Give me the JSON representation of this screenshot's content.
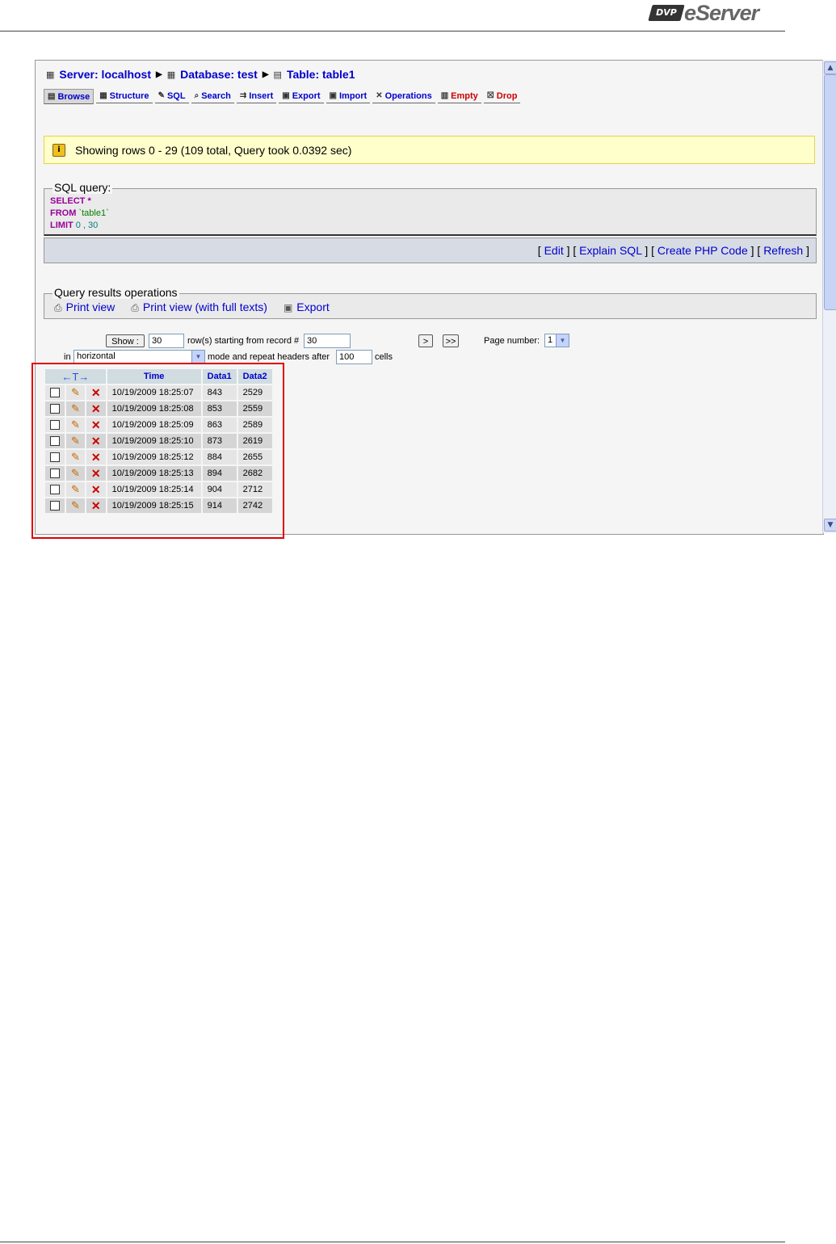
{
  "brand": {
    "badge": "DVP",
    "word": "eServer"
  },
  "breadcrumb": {
    "server": "Server: localhost",
    "database": "Database: test",
    "table": "Table: table1"
  },
  "tabs": [
    {
      "label": "Browse",
      "icon": "browse-icon"
    },
    {
      "label": "Structure",
      "icon": "structure-icon"
    },
    {
      "label": "SQL",
      "icon": "sql-icon"
    },
    {
      "label": "Search",
      "icon": "search-icon"
    },
    {
      "label": "Insert",
      "icon": "insert-icon"
    },
    {
      "label": "Export",
      "icon": "export-icon"
    },
    {
      "label": "Import",
      "icon": "import-icon"
    },
    {
      "label": "Operations",
      "icon": "operations-icon"
    },
    {
      "label": "Empty",
      "icon": "empty-icon"
    },
    {
      "label": "Drop",
      "icon": "drop-icon"
    }
  ],
  "notice": {
    "text": "Showing rows 0 - 29 (109 total, Query took 0.0392 sec)"
  },
  "sql": {
    "legend": "SQL query:",
    "select_kw": "SELECT",
    "select_rest": " *",
    "from_kw": "FROM",
    "from_rest": " `table1`",
    "limit_kw": "LIMIT",
    "limit_rest": " 0 , 30",
    "actions": {
      "edit": "Edit",
      "explain": "Explain SQL",
      "php": "Create PHP Code",
      "refresh": "Refresh"
    }
  },
  "query_ops": {
    "legend": "Query results operations",
    "print": "Print view",
    "print_full": "Print view (with full texts)",
    "export": "Export"
  },
  "navigation": {
    "show": "Show :",
    "rows": "30",
    "rows_label": "row(s) starting from record #",
    "start": "30",
    "next": ">",
    "last": ">>",
    "page_label": "Page number:",
    "page": "1",
    "in_label": "in",
    "mode": "horizontal",
    "mode_label": "mode and repeat headers after",
    "repeat": "100",
    "cells_label": "cells"
  },
  "table": {
    "arrows": "←T→",
    "columns": [
      "Time",
      "Data1",
      "Data2"
    ],
    "rows": [
      [
        "10/19/2009 18:25:07",
        "843",
        "2529"
      ],
      [
        "10/19/2009 18:25:08",
        "853",
        "2559"
      ],
      [
        "10/19/2009 18:25:09",
        "863",
        "2589"
      ],
      [
        "10/19/2009 18:25:10",
        "873",
        "2619"
      ],
      [
        "10/19/2009 18:25:12",
        "884",
        "2655"
      ],
      [
        "10/19/2009 18:25:13",
        "894",
        "2682"
      ],
      [
        "10/19/2009 18:25:14",
        "904",
        "2712"
      ],
      [
        "10/19/2009 18:25:15",
        "914",
        "2742"
      ]
    ]
  }
}
